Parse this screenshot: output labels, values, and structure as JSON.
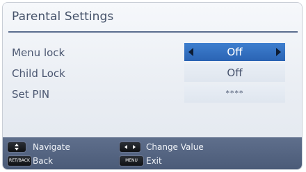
{
  "title": "Parental Settings",
  "rows": [
    {
      "label": "Menu lock",
      "value": "Off",
      "selected": true
    },
    {
      "label": "Child Lock",
      "value": "Off",
      "selected": false
    },
    {
      "label": "Set PIN",
      "value": "****",
      "selected": false
    }
  ],
  "footer": {
    "navigate_label": "Navigate",
    "change_value_label": "Change Value",
    "back_key_text": "RET/BACK",
    "back_label": "Back",
    "menu_key_text": "MENU",
    "exit_label": "Exit"
  },
  "colors": {
    "selection": "#2f6dc0",
    "footer": "#56667f",
    "title_rule": "#5a6d8e"
  },
  "icons": [
    "up-down-key-icon",
    "left-right-key-icon",
    "left-arrow-icon",
    "right-arrow-icon"
  ]
}
